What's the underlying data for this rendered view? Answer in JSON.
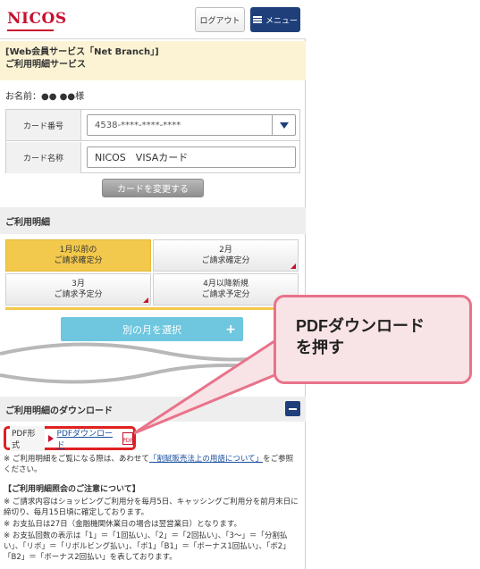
{
  "header": {
    "logo": "NICOS",
    "logout_label": "ログアウト",
    "menu_label": "メニュー"
  },
  "service": {
    "line1": "[Web会員サービス「Net Branch」]",
    "line2": "ご利用明細サービス"
  },
  "user": {
    "name_label": "お名前：●● ●●様"
  },
  "card": {
    "number_label": "カード番号",
    "number_value": "4538-****-****-****",
    "name_label": "カード名称",
    "name_value": "NICOS　VISAカード",
    "change_button": "カードを変更する"
  },
  "statements": {
    "section_title": "ご利用明細",
    "tabs": [
      {
        "line1": "1月以前の",
        "line2": "ご請求確定分"
      },
      {
        "line1": "2月",
        "line2": "ご請求確定分"
      },
      {
        "line1": "3月",
        "line2": "ご請求予定分"
      },
      {
        "line1": "4月以降新規",
        "line2": "ご請求予定分"
      }
    ],
    "select_month_button": "別の月を選択"
  },
  "download": {
    "section_title": "ご利用明細のダウンロード",
    "format_label": "PDF形式",
    "link_label": "PDFダウンロード",
    "note_prefix": "※ ご利用明細をご覧になる際は、あわせて",
    "note_link": "「割賦販売法上の用語について」",
    "note_suffix": "をご参照ください。"
  },
  "notice": {
    "title": "【ご利用明細照会のご注意について】",
    "items": [
      "※ ご請求内容はショッピングご利用分を毎月5日、キャッシングご利用分を前月末日に締切り、毎月15日頃に確定しております。",
      "※ お支払日は27日（金融機関休業日の場合は翌営業日）となります。",
      "※ お支払回数の表示は「1」＝「1回払い」、「2」＝「2回払い」、「3〜」＝「分割払い」、「リボ」＝「リボルビング払い」、「ボ1」「B1」＝「ボーナス1回払い」、「ボ2」「B2」＝「ボーナス2回払い」を表しております。"
    ]
  },
  "callout": {
    "line1": "PDFダウンロード",
    "line2": "を押す"
  }
}
